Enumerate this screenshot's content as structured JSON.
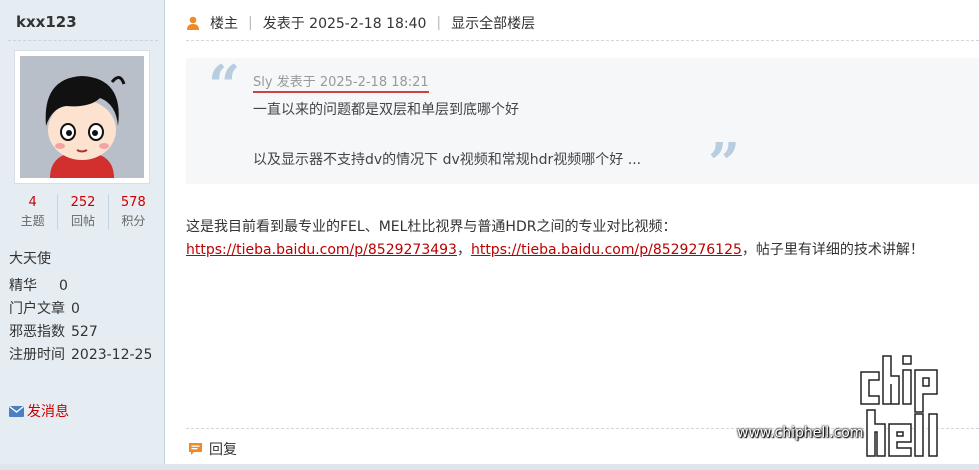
{
  "user": {
    "name": "kxx123",
    "stats": [
      {
        "value": "4",
        "label": "主题"
      },
      {
        "value": "252",
        "label": "回帖"
      },
      {
        "value": "578",
        "label": "积分"
      }
    ],
    "group": "大天使",
    "info": [
      {
        "key": "精华",
        "value": "0"
      },
      {
        "key": "门户文章",
        "value": "0"
      },
      {
        "key": "邪恶指数",
        "value": "527"
      },
      {
        "key": "注册时间",
        "value": "2023-12-25"
      }
    ],
    "send_pm": "发消息"
  },
  "post": {
    "floor": "楼主",
    "posted": "发表于 2025-2-18 18:40",
    "show_all": "显示全部楼层",
    "quote": {
      "author": "Sly 发表于 2025-2-18 18:21",
      "line1": "一直以来的问题都是双层和单层到底哪个好",
      "line2": "以及显示器不支持dv的情况下 dv视频和常规hdr视频哪个好 ..."
    },
    "body": {
      "intro": "这是我目前看到最专业的FEL、MEL杜比视界与普通HDR之间的专业对比视频：",
      "link1": "https://tieba.baidu.com/p/8529273493",
      "comma": "，",
      "link2": "https://tieba.baidu.com/p/8529276125",
      "outro": "，帖子里有详细的技术讲解！"
    },
    "reply": "回复"
  },
  "watermark": {
    "url": "www.chiphell.com"
  },
  "colors": {
    "sidebar_bg": "#e5edf2",
    "link_red": "#bb0000",
    "stat_red": "#cc0000",
    "quote_bg": "#f5f7f9"
  },
  "icons": [
    "user-icon",
    "mail-icon",
    "reply-icon",
    "quote-open-icon",
    "quote-close-icon"
  ]
}
